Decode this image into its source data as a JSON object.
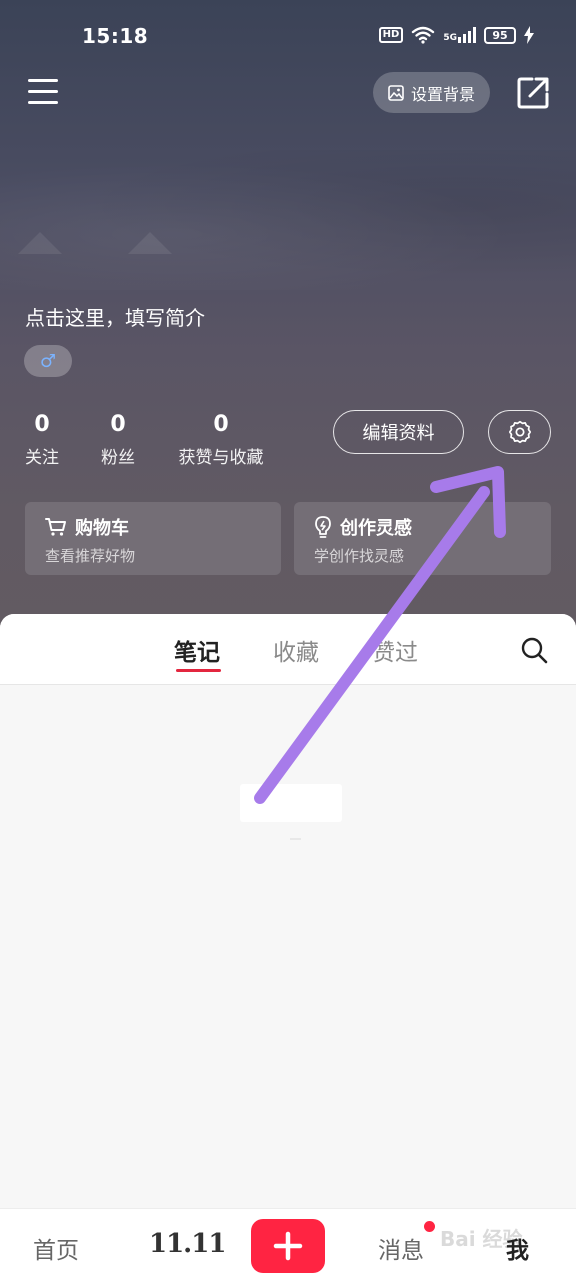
{
  "status_bar": {
    "time": "15:18",
    "hd": "HD",
    "network": "5G",
    "battery": "95"
  },
  "top_bar": {
    "set_background_label": "设置背景"
  },
  "profile": {
    "bio_placeholder": "点击这里，填写简介",
    "gender_symbol": "♂",
    "stats": [
      {
        "value": "0",
        "label": "关注"
      },
      {
        "value": "0",
        "label": "粉丝"
      },
      {
        "value": "0",
        "label": "获赞与收藏"
      }
    ],
    "edit_profile_label": "编辑资料"
  },
  "cards": [
    {
      "title": "购物车",
      "subtitle": "查看推荐好物",
      "icon": "cart-icon"
    },
    {
      "title": "创作灵感",
      "subtitle": "学创作找灵感",
      "icon": "lightbulb-icon"
    }
  ],
  "tabs": [
    {
      "label": "笔记",
      "active": true
    },
    {
      "label": "收藏",
      "active": false
    },
    {
      "label": "赞过",
      "active": false
    }
  ],
  "bottom_nav": {
    "home": "首页",
    "event": "11.11",
    "messages": "消息",
    "me": "我",
    "watermark": "Bai 经验"
  },
  "colors": {
    "accent_red": "#ff2442",
    "annotation_arrow": "#a77bea"
  }
}
